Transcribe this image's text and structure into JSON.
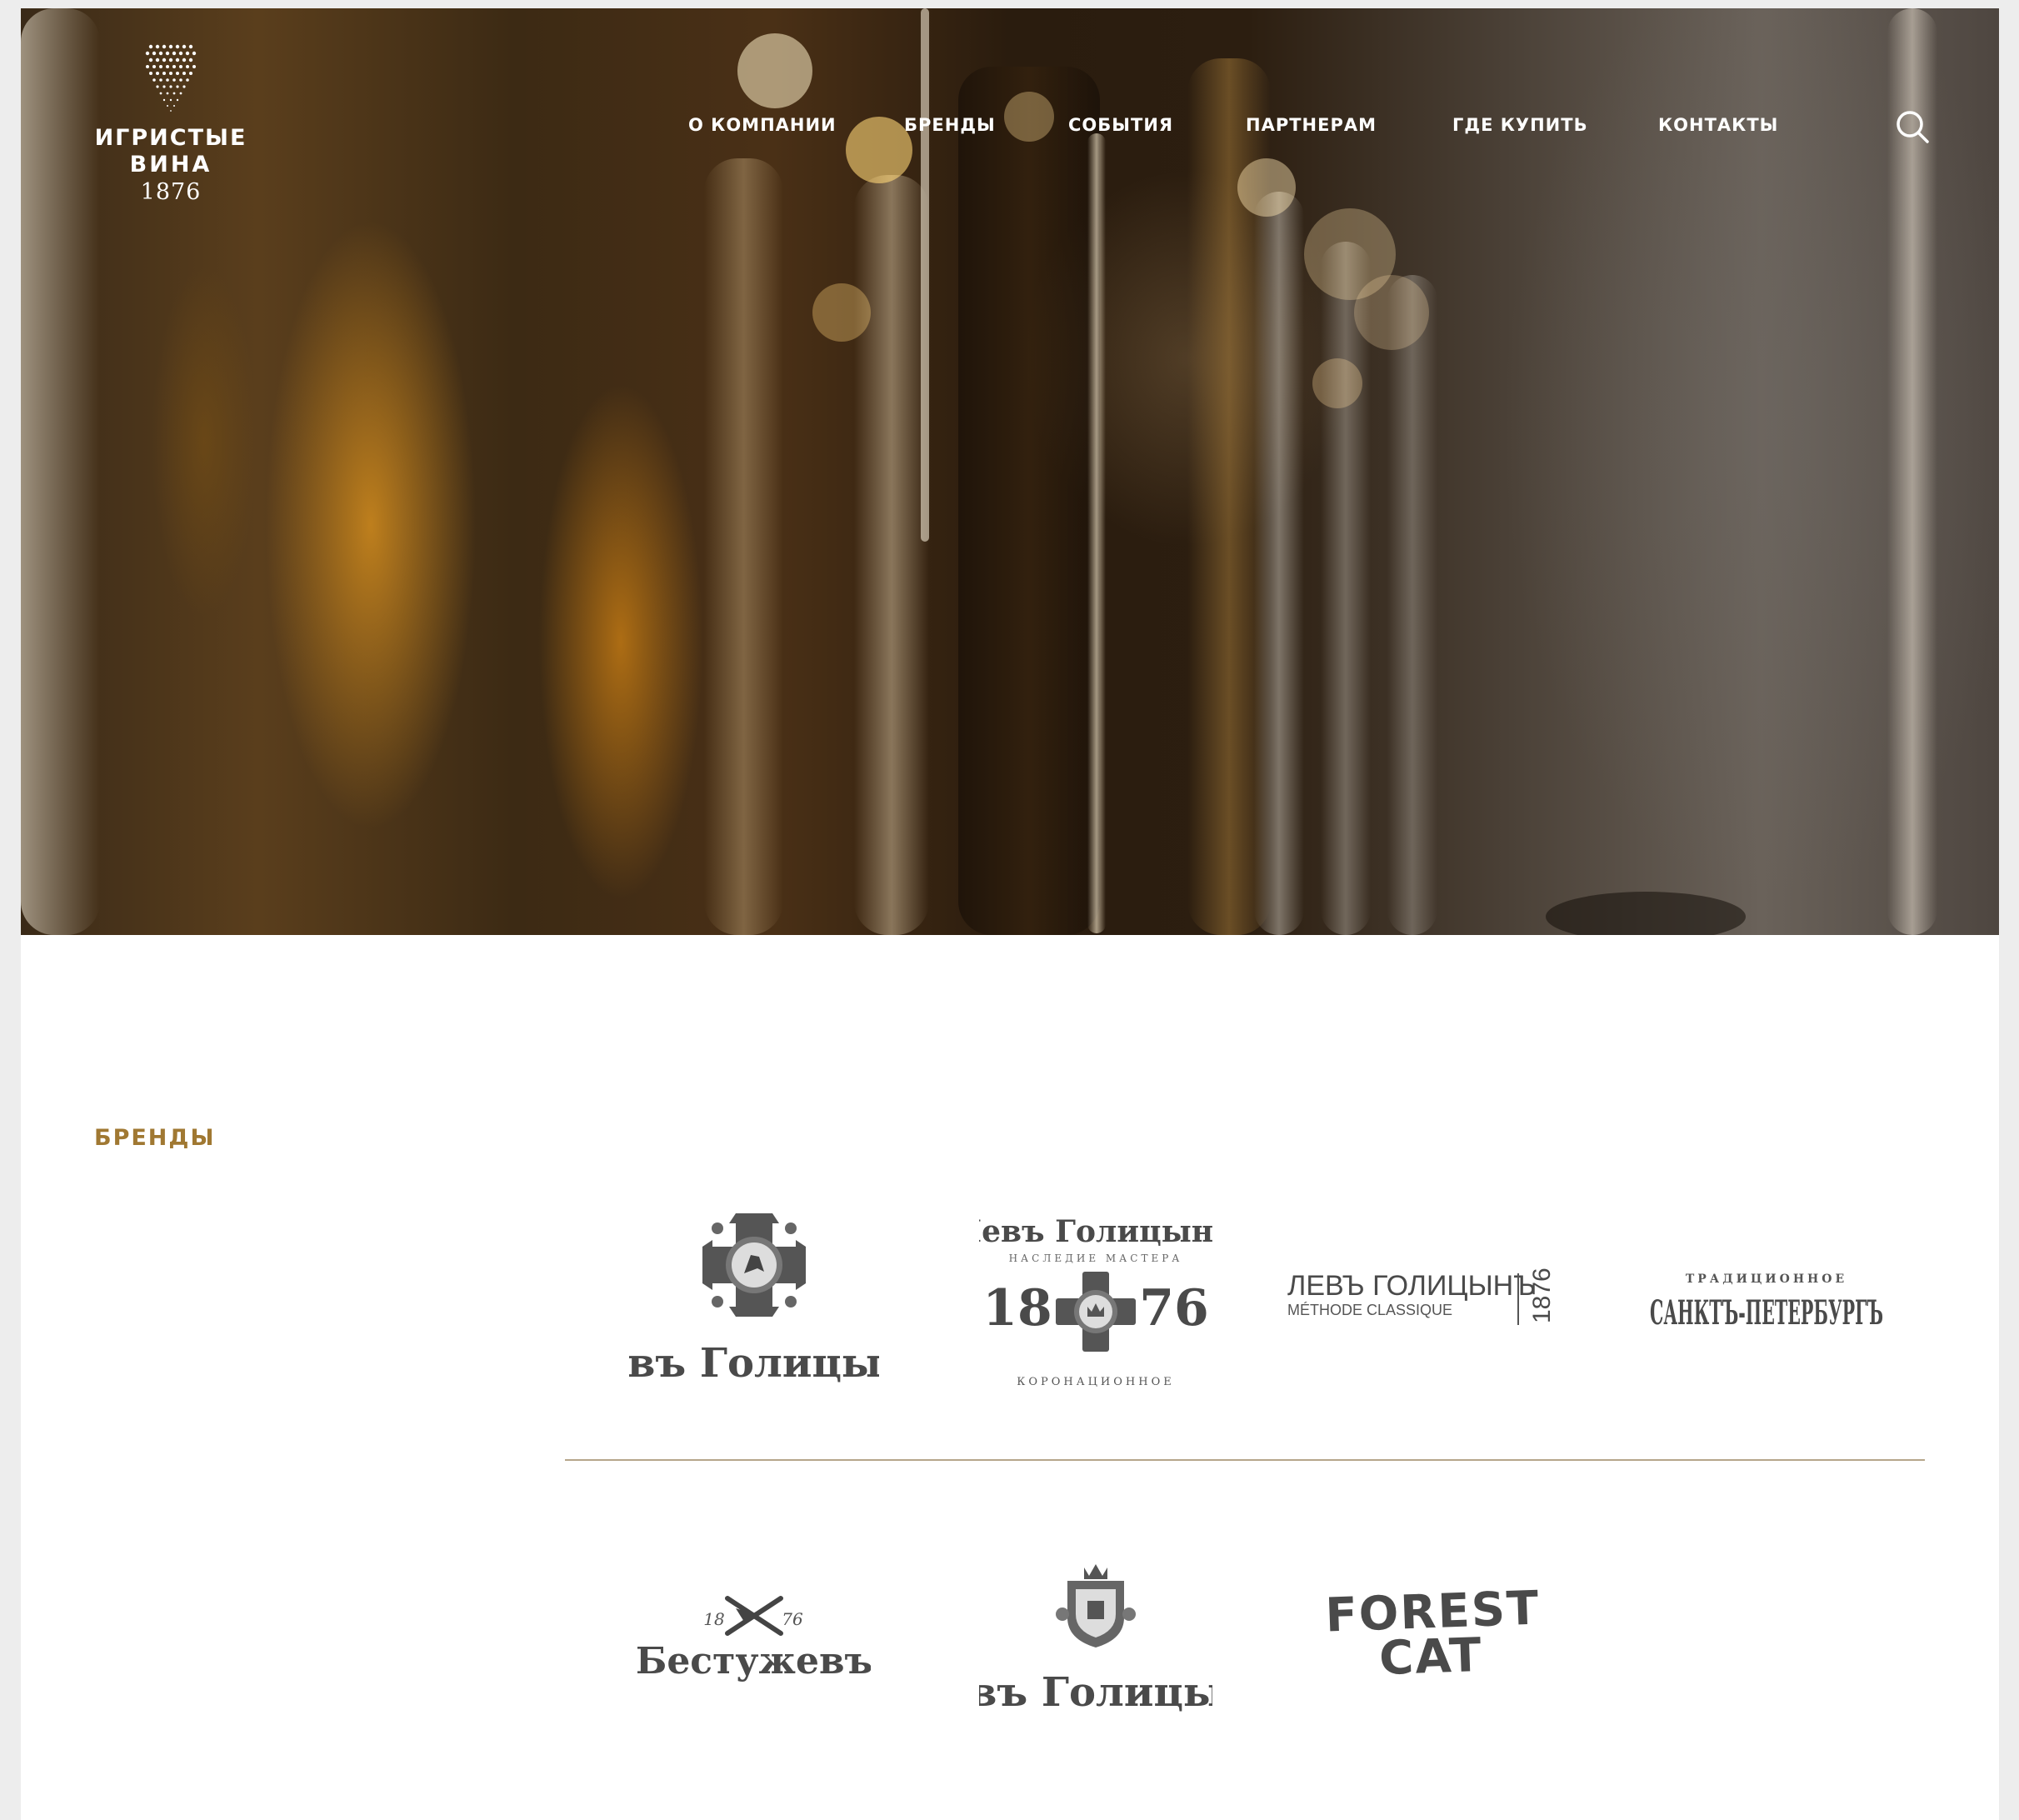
{
  "logo": {
    "line1": "ИГРИСТЫЕ",
    "line2": "ВИНА",
    "year": "1876"
  },
  "nav": {
    "items": [
      "О КОМПАНИИ",
      "БРЕНДЫ",
      "СОБЫТИЯ",
      "ПАРТНЕРАМ",
      "ГДЕ КУПИТЬ",
      "КОНТАКТЫ"
    ]
  },
  "search": {
    "icon": "search-icon"
  },
  "brands_section": {
    "title": "БРЕНДЫ",
    "brands": [
      {
        "name": "Левъ Голицынъ",
        "icon": "cross-emblem-icon"
      },
      {
        "top": "Левъ Голицынъ",
        "sub": "НАСЛЕДИЕ МАСТЕРА",
        "year_left": "18",
        "year_right": "76",
        "bottom": "КОРОНАЦИОННОЕ",
        "icon": "coronation-cross-icon"
      },
      {
        "name": "ЛЕВЪ ГОЛИЦЫНЪ",
        "sub": "MÉTHODE CLASSIQUE",
        "year": "1876"
      },
      {
        "top": "ТРАДИЦИОННОЕ",
        "name": "САНКТЪ-ПЕТЕРБУРГЪ"
      },
      {
        "name": "Бестужевъ",
        "year_left": "18",
        "year_right": "76",
        "icon": "crossed-swords-icon"
      },
      {
        "name": "Левъ Голицынъ",
        "icon": "coat-of-arms-icon"
      },
      {
        "line1": "FOREST",
        "line2": "CAT"
      }
    ]
  },
  "colors": {
    "accent": "#a07832",
    "divider": "#b6a68a",
    "logo_gray": "#4a4a4a",
    "background": "#ffffff",
    "frame": "#ededed"
  }
}
